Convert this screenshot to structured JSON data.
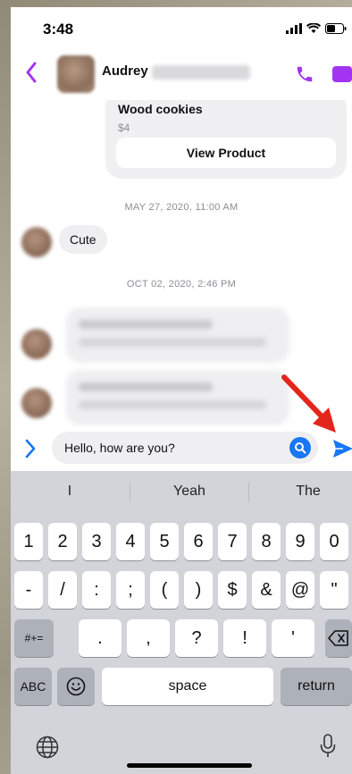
{
  "status": {
    "time": "3:48"
  },
  "header": {
    "contact_name": "Audrey"
  },
  "product": {
    "title": "Wood cookies",
    "price": "$4",
    "button": "View Product"
  },
  "messages": {
    "timestamp1": "MAY 27, 2020, 11:00 AM",
    "bubble1": "Cute",
    "timestamp2": "OCT 02, 2020, 2:46 PM"
  },
  "composer": {
    "text": "Hello, how are you?"
  },
  "keyboard": {
    "suggestions": [
      "I",
      "Yeah",
      "The"
    ],
    "row1": [
      "1",
      "2",
      "3",
      "4",
      "5",
      "6",
      "7",
      "8",
      "9",
      "0"
    ],
    "row2": [
      "-",
      "/",
      ":",
      ";",
      "(",
      ")",
      "$",
      "&",
      "@",
      "\""
    ],
    "row3_left": "#+=",
    "row3": [
      ".",
      ",",
      "?",
      "!",
      "'"
    ],
    "abc": "ABC",
    "space": "space",
    "return": "return"
  },
  "colors": {
    "accent": "#a335f2",
    "send": "#1877f2",
    "arrow": "#e3261c"
  }
}
